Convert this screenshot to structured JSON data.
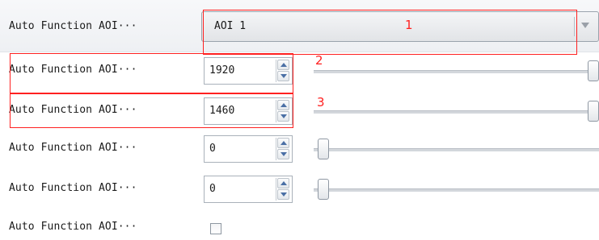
{
  "rows": [
    {
      "label": "Auto Function AOI···",
      "value": "AOI 1"
    },
    {
      "label": "Auto Function AOI···",
      "value": "1920",
      "slider_level": 1.0
    },
    {
      "label": "Auto Function AOI···",
      "value": "1460",
      "slider_level": 1.0
    },
    {
      "label": "Auto Function AOI···",
      "value": "0",
      "slider_level": 0.0
    },
    {
      "label": "Auto Function AOI···",
      "value": "0",
      "slider_level": 0.0
    },
    {
      "label": "Auto Function AOI···",
      "checked": false
    }
  ],
  "annotations": [
    "1",
    "2",
    "3"
  ],
  "annotation_color": "#ff2020",
  "icons": {
    "combo_arrow": "chevron-down-icon",
    "spin_up": "arrow-up-icon",
    "spin_down": "arrow-down-icon"
  }
}
